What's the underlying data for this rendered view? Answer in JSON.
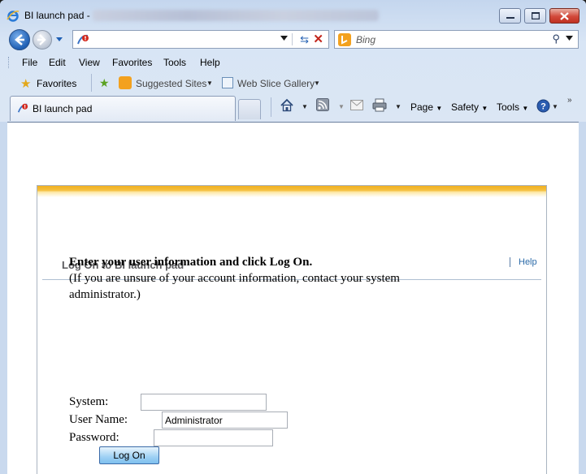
{
  "window": {
    "title": "BI launch pad -"
  },
  "address_bar": {
    "value": ""
  },
  "search": {
    "placeholder": "Bing"
  },
  "menu": {
    "items": [
      "File",
      "Edit",
      "View",
      "Favorites",
      "Tools",
      "Help"
    ]
  },
  "favorites_bar": {
    "favorites_label": "Favorites",
    "suggested_sites": "Suggested Sites",
    "web_slice_gallery": "Web Slice Gallery"
  },
  "tab": {
    "label": "BI launch pad"
  },
  "command_bar": {
    "page": "Page",
    "safety": "Safety",
    "tools": "Tools"
  },
  "page": {
    "title": "Log On to BI launch pad",
    "help": "Help",
    "instruction_bold": "Enter your user information and click Log On.",
    "instruction_note": "(If you are unsure of your account information, contact your system administrator.)",
    "system_label": "System:",
    "system_value": "",
    "username_label": "User Name:",
    "username_value": "Administrator",
    "password_label": "Password:",
    "password_value": "",
    "logon_button": "Log On"
  },
  "colors": {
    "accent_gold": "#f0b020",
    "help_link": "#2a6aa8",
    "close_button": "#d2483a"
  }
}
